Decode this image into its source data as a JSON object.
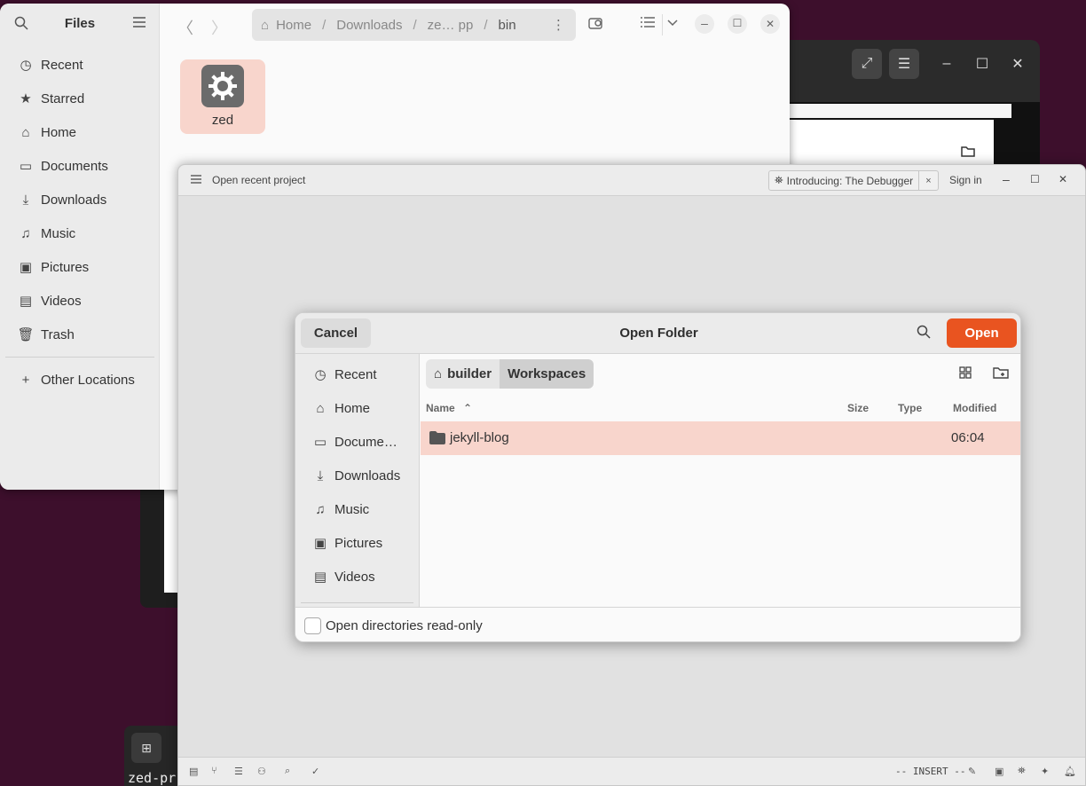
{
  "files_window": {
    "title": "Files",
    "sidebar": [
      {
        "label": "Recent",
        "icon": "clock-icon"
      },
      {
        "label": "Starred",
        "icon": "star-icon"
      },
      {
        "label": "Home",
        "icon": "home-icon"
      },
      {
        "label": "Documents",
        "icon": "document-icon"
      },
      {
        "label": "Downloads",
        "icon": "download-icon"
      },
      {
        "label": "Music",
        "icon": "music-icon"
      },
      {
        "label": "Pictures",
        "icon": "picture-icon"
      },
      {
        "label": "Videos",
        "icon": "video-icon"
      },
      {
        "label": "Trash",
        "icon": "trash-icon"
      }
    ],
    "other_locations": "Other Locations",
    "path": {
      "home": "Home",
      "downloads": "Downloads",
      "middle": "ze… pp",
      "current": "bin"
    },
    "file": {
      "name": "zed",
      "icon": "gear-icon"
    }
  },
  "zed_window": {
    "project_label": "Open recent project",
    "banner": "Introducing: The Debugger",
    "banner_close": "×",
    "sign_in": "Sign in",
    "mode": "-- INSERT --"
  },
  "dialog": {
    "title": "Open Folder",
    "cancel": "Cancel",
    "open": "Open",
    "sidebar": [
      {
        "label": "Recent",
        "icon": "clock-icon"
      },
      {
        "label": "Home",
        "icon": "home-icon"
      },
      {
        "label": "Docume…",
        "icon": "document-icon"
      },
      {
        "label": "Downloads",
        "icon": "download-icon"
      },
      {
        "label": "Music",
        "icon": "music-icon"
      },
      {
        "label": "Pictures",
        "icon": "picture-icon"
      },
      {
        "label": "Videos",
        "icon": "video-icon"
      }
    ],
    "crumbs": [
      "builder",
      "Workspaces"
    ],
    "columns": {
      "name": "Name",
      "size": "Size",
      "type": "Type",
      "modified": "Modified"
    },
    "rows": [
      {
        "name": "jekyll-blog",
        "size": "",
        "type": "",
        "modified": "06:04"
      }
    ],
    "readonly_label": "Open directories read-only"
  },
  "terminal": {
    "label": "zed-pr"
  },
  "colors": {
    "accent": "#e95420",
    "selection": "#f8d5cc",
    "desktop": "#3d0f2c"
  }
}
